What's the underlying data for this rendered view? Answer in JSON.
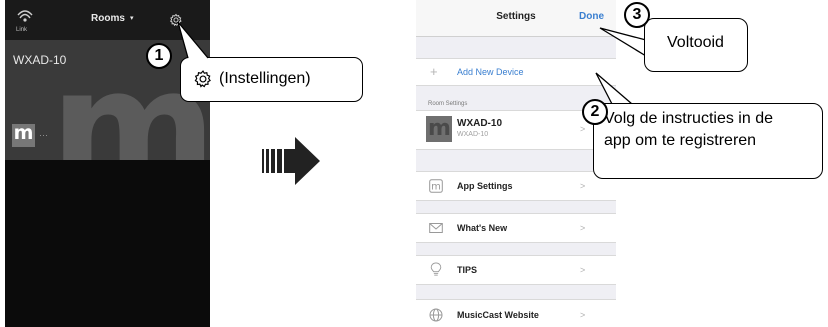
{
  "left_phone": {
    "link_label": "Link",
    "rooms_title": "Rooms",
    "rooms_caret": "▾",
    "room_name": "WXAD-10",
    "thumb_letter": "m",
    "thumb_dots": "···"
  },
  "callouts": {
    "step1": {
      "number": "1",
      "text": "(Instellingen)"
    },
    "step2": {
      "number": "2",
      "line1": "Volg de instructies in de",
      "line2": "app om te registreren"
    },
    "step3": {
      "number": "3",
      "text": "Voltooid"
    }
  },
  "settings": {
    "title": "Settings",
    "done": "Done",
    "add_new_device": "Add New Device",
    "room_settings_header": "Room Settings",
    "room": {
      "name": "WXAD-10",
      "sub": "WXAD-10"
    },
    "app_settings": "App Settings",
    "whats_new": "What's New",
    "tips": "TIPS",
    "website": "MusicCast Website",
    "chevron": ">",
    "plus": "+"
  },
  "colors": {
    "accent": "#3a7fd0",
    "dark_bg": "#0b0b0b",
    "card_bg": "#3a3a3a",
    "ios_bg": "#efeff4"
  }
}
